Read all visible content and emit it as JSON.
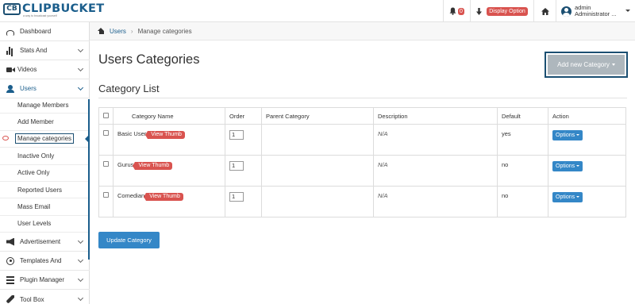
{
  "header": {
    "logo_text": "CLIPBUCKET",
    "logo_mark": "CB",
    "logo_tagline": "a way to broadcast yourself",
    "notifications_count": "0",
    "display_option_label": "Display Option",
    "user_name": "admin",
    "user_role": "Administrator ..."
  },
  "sidebar": {
    "items": [
      {
        "label": "Dashboard",
        "icon": "dashboard-icon"
      },
      {
        "label": "Stats And",
        "icon": "bar-chart-icon"
      },
      {
        "label": "Videos",
        "icon": "video-camera-icon"
      },
      {
        "label": "Users",
        "icon": "user-icon"
      },
      {
        "label": "Advertisement",
        "icon": "megaphone-icon"
      },
      {
        "label": "Templates And",
        "icon": "play-circle-icon"
      },
      {
        "label": "Plugin Manager",
        "icon": "stack-icon"
      },
      {
        "label": "Tool Box",
        "icon": "wrench-icon"
      }
    ],
    "users_submenu": [
      "Manage Members",
      "Add Member",
      "Manage categories",
      "Inactive Only",
      "Active Only",
      "Reported Users",
      "Mass Email",
      "User Levels"
    ]
  },
  "breadcrumb": {
    "home": "Users",
    "current": "Manage categories"
  },
  "main": {
    "title": "Users Categories",
    "add_button": "Add new Category",
    "section_title": "Category List",
    "update_button": "Update Category"
  },
  "table": {
    "headers": [
      "Category Name",
      "Order",
      "Parent Category",
      "Description",
      "Default",
      "Action"
    ],
    "view_thumb_label": "View Thumb",
    "options_label": "Options",
    "rows": [
      {
        "name": "Basic User",
        "order": "1",
        "parent": "",
        "description": "N/A",
        "default": "yes"
      },
      {
        "name": "Gurus",
        "order": "1",
        "parent": "",
        "description": "N/A",
        "default": "no"
      },
      {
        "name": "Comedian",
        "order": "1",
        "parent": "",
        "description": "N/A",
        "default": "no"
      }
    ]
  },
  "colors": {
    "brand": "#1b5e8c",
    "danger": "#d9534f",
    "primary": "#3487c7",
    "disabled": "#aeb7bd"
  }
}
